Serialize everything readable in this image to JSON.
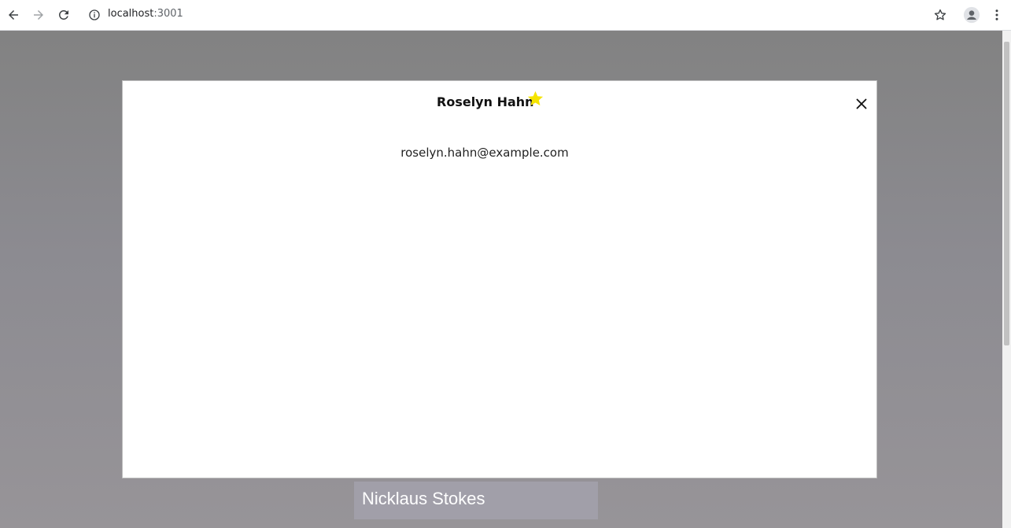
{
  "browser": {
    "url_host": "localhost",
    "url_port": ":3001",
    "icons": {
      "back": "arrow-left-icon",
      "forward": "arrow-right-icon",
      "reload": "reload-icon",
      "site_info": "info-icon",
      "bookmark": "star-outline-icon",
      "profile": "account-circle-icon",
      "menu": "vertical-dots-icon"
    }
  },
  "modal": {
    "title": "Roselyn Hahn",
    "email": "roselyn.hahn@example.com",
    "favorite": true,
    "star_color": "#f5e400",
    "close_icon": "close-icon"
  },
  "background": {
    "card_name": "Nicklaus Stokes"
  }
}
